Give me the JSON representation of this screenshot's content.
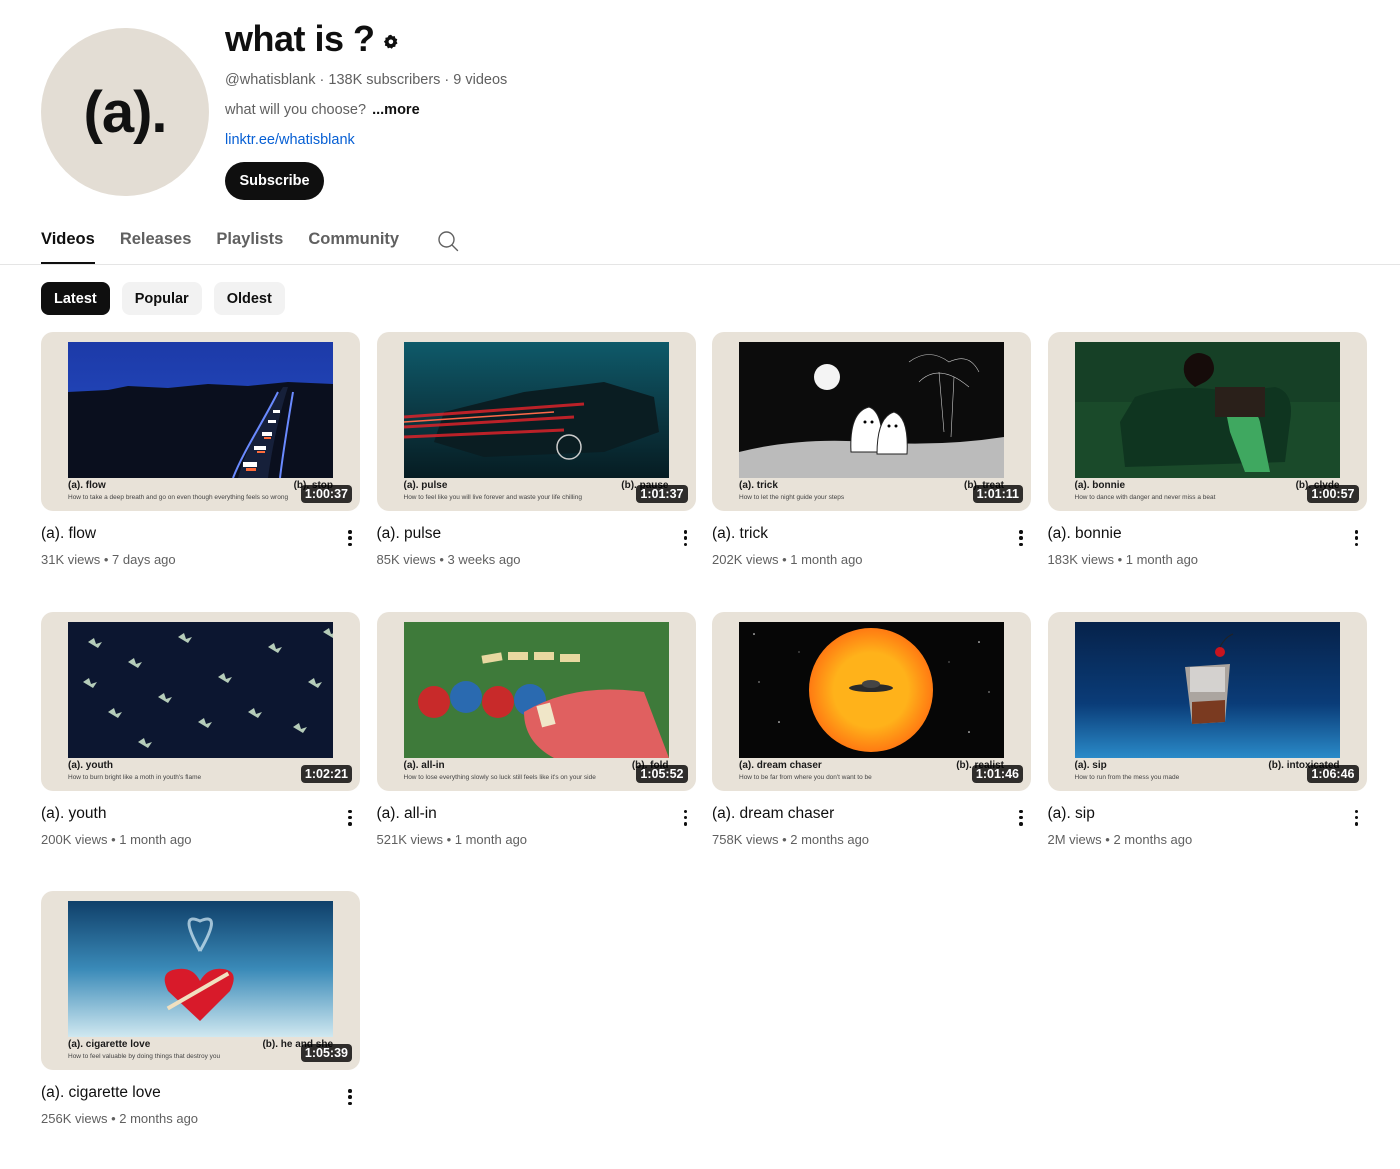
{
  "channel": {
    "avatar_text": "(a).",
    "title": "what is ?",
    "handle": "@whatisblank",
    "subscribers": "138K subscribers",
    "video_count": "9 videos",
    "separator": " · ",
    "description": "what will you choose?",
    "more": "...more",
    "link": "linktr.ee/whatisblank",
    "subscribe_label": "Subscribe"
  },
  "tabs": [
    {
      "label": "Videos",
      "active": true
    },
    {
      "label": "Releases",
      "active": false
    },
    {
      "label": "Playlists",
      "active": false
    },
    {
      "label": "Community",
      "active": false
    }
  ],
  "chips": [
    {
      "label": "Latest",
      "active": true
    },
    {
      "label": "Popular",
      "active": false
    },
    {
      "label": "Oldest",
      "active": false
    }
  ],
  "videos": [
    {
      "title": "(a). flow",
      "views": "31K views",
      "age": "7 days ago",
      "duration": "1:00:37",
      "cap_a": "(a). flow",
      "cap_sub": "How to take a deep breath and go on even though everything feels so wrong",
      "cap_b": "(b). stop",
      "art": "road"
    },
    {
      "title": "(a). pulse",
      "views": "85K views",
      "age": "3 weeks ago",
      "duration": "1:01:37",
      "cap_a": "(a). pulse",
      "cap_sub": "How to feel like you will live forever and waste your life chilling",
      "cap_b": "(b). pause",
      "art": "car"
    },
    {
      "title": "(a). trick",
      "views": "202K views",
      "age": "1 month ago",
      "duration": "1:01:11",
      "cap_a": "(a). trick",
      "cap_sub": "How to let the night guide your steps",
      "cap_b": "(b). treat",
      "art": "ghosts"
    },
    {
      "title": "(a). bonnie",
      "views": "183K views",
      "age": "1 month ago",
      "duration": "1:00:57",
      "cap_a": "(a). bonnie",
      "cap_sub": "How to dance with danger and never miss a beat",
      "cap_b": "(b). clyde",
      "art": "bonnie"
    },
    {
      "title": "(a). youth",
      "views": "200K views",
      "age": "1 month ago",
      "duration": "1:02:21",
      "cap_a": "(a). youth",
      "cap_sub": "How to burn bright like a moth in youth's flame",
      "cap_b": "",
      "art": "moths"
    },
    {
      "title": "(a). all-in",
      "views": "521K views",
      "age": "1 month ago",
      "duration": "1:05:52",
      "cap_a": "(a). all-in",
      "cap_sub": "How to lose everything slowly so luck still feels like it's on your side",
      "cap_b": "(b). fold",
      "art": "poker"
    },
    {
      "title": "(a). dream chaser",
      "views": "758K views",
      "age": "2 months ago",
      "duration": "1:01:46",
      "cap_a": "(a). dream chaser",
      "cap_sub": "How to be far from where you don't want to be",
      "cap_b": "(b). realist",
      "art": "sun"
    },
    {
      "title": "(a). sip",
      "views": "2M views",
      "age": "2 months ago",
      "duration": "1:06:46",
      "cap_a": "(a). sip",
      "cap_sub": "How to run from the mess you made",
      "cap_b": "(b). intoxicated",
      "art": "glass"
    },
    {
      "title": "(a). cigarette love",
      "views": "256K views",
      "age": "2 months ago",
      "duration": "1:05:39",
      "cap_a": "(a). cigarette love",
      "cap_sub": "How to feel valuable by doing things that destroy you",
      "cap_b": "(b). he and she",
      "art": "heart"
    }
  ],
  "meta_separator": " • ",
  "icons": {
    "verified": "verified-icon",
    "search": "search-icon",
    "more": "more-vert-icon"
  }
}
